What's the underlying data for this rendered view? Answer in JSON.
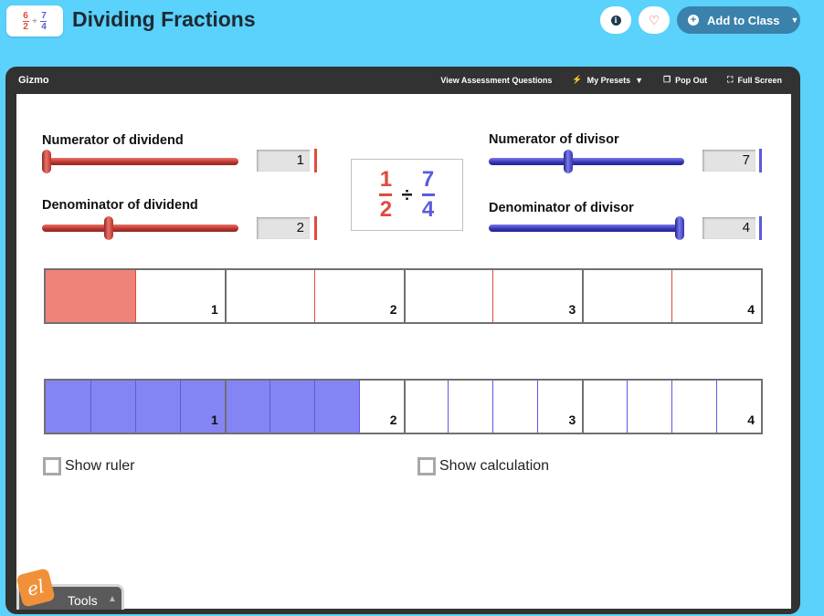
{
  "header": {
    "logo": {
      "dividend": {
        "numerator": "6",
        "denominator": "2"
      },
      "operator": "÷",
      "divisor": {
        "numerator": "7",
        "denominator": "4"
      }
    },
    "title": "Dividing Fractions",
    "info_icon": "info-icon",
    "favorite_icon": "heart-icon",
    "add_to_class_label": "Add to Class"
  },
  "gizmo": {
    "label": "Gizmo",
    "toolbar": {
      "assessment": "View Assessment Questions",
      "presets": "My Presets",
      "pop_out": "Pop Out",
      "full_screen": "Full Screen"
    }
  },
  "controls": {
    "dividend_numerator": {
      "label": "Numerator of dividend",
      "value": "1",
      "fraction": 0.0
    },
    "dividend_denominator": {
      "label": "Denominator of dividend",
      "value": "2",
      "fraction": 0.33
    },
    "divisor_numerator": {
      "label": "Numerator of divisor",
      "value": "7",
      "fraction": 0.4
    },
    "divisor_denominator": {
      "label": "Denominator of divisor",
      "value": "4",
      "fraction": 1.0
    }
  },
  "expression": {
    "dividend": {
      "numerator": "1",
      "denominator": "2"
    },
    "operator": "÷",
    "divisor": {
      "numerator": "7",
      "denominator": "4"
    }
  },
  "dividend_bar": {
    "wholes": 4,
    "parts_per_whole": 2,
    "filled_parts": 1,
    "labels": [
      "1",
      "2",
      "3",
      "4"
    ],
    "fill_color": "#f08378",
    "line_color": "#e04b3d"
  },
  "divisor_bar": {
    "wholes": 4,
    "parts_per_whole": 4,
    "filled_parts": 7,
    "labels": [
      "1",
      "2",
      "3",
      "4"
    ],
    "fill_color": "#8484f4",
    "line_color": "#5b5bdc"
  },
  "options": {
    "show_ruler": {
      "label": "Show ruler",
      "checked": false
    },
    "show_calculation": {
      "label": "Show calculation",
      "checked": false
    }
  },
  "tools": {
    "label": "Tools"
  }
}
